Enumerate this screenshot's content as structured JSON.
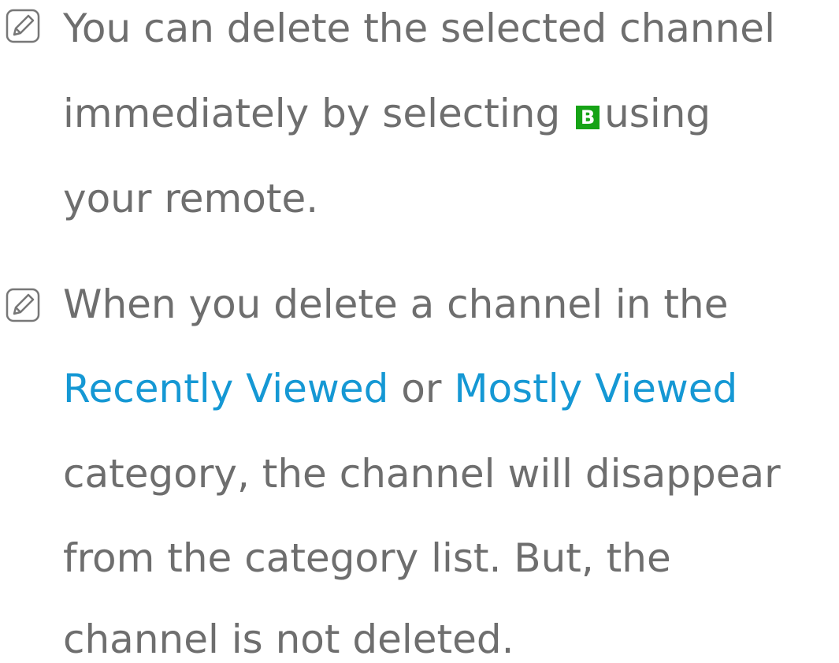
{
  "notes": [
    {
      "icon": "note-pencil-icon",
      "lines": {
        "l1": "You can delete the selected channel",
        "l2_before": "immediately by selecting",
        "l2_key": "B",
        "l2_after": "using",
        "l3": "your remote."
      }
    },
    {
      "icon": "note-pencil-icon",
      "lines": {
        "l1": "When you delete a channel in the",
        "l2_hl1": "Recently Viewed",
        "l2_mid": "or",
        "l2_hl2": "Mostly Viewed",
        "l3": "category, the channel will disappear",
        "l4": "from the category list. But, the",
        "l5": "channel is not deleted."
      }
    }
  ],
  "colors": {
    "text": "#6e6e6e",
    "highlight": "#1598d4",
    "b_key": "#16a316"
  }
}
